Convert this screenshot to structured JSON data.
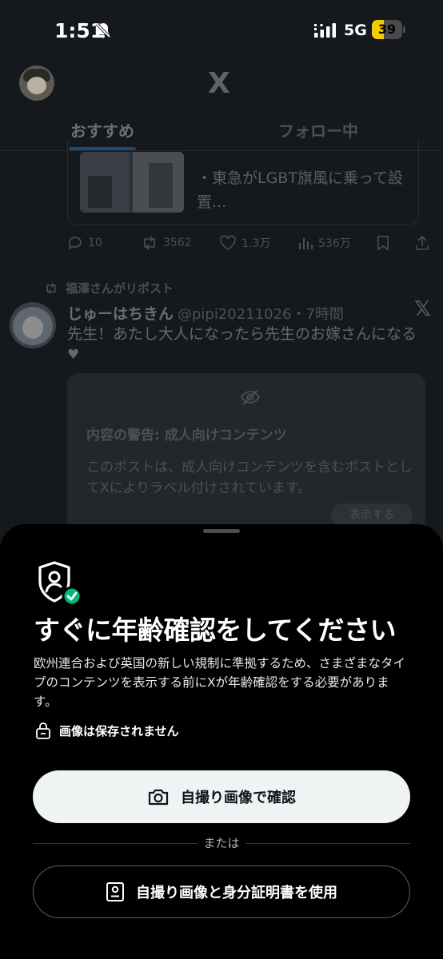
{
  "status_bar": {
    "time": "1:51",
    "network": "5G",
    "battery": "39",
    "battery_level": 0.39
  },
  "header": {
    "logo": "X",
    "tabs": [
      {
        "label": "おすすめ",
        "active": true
      },
      {
        "label": "フォロー中",
        "active": false
      }
    ]
  },
  "feed": {
    "post1": {
      "link_text": "・東急がLGBT旗風に乗って設置...",
      "actions": {
        "replies": "10",
        "reposts": "3562",
        "likes": "1.3万",
        "views": "536万"
      }
    },
    "post2": {
      "repost_by": "福澤さんがリポスト",
      "author": "じゅーはちきん",
      "handle_time": "@pipi20211026・7時間",
      "text": "先生！あたし大人になったら先生のお嫁さんになる",
      "heart": "♥",
      "warning": {
        "title": "内容の警告: 成人向けコンテンツ",
        "body": "このポストは、成人向けコンテンツを含むポストとしてXによりラベル付けされています。",
        "show_label": "表示する"
      }
    }
  },
  "sheet": {
    "title": "すぐに年齢確認をしてください",
    "description": "欧州連合および英国の新しい規制に準拠するため、さまざまなタイプのコンテンツを表示する前にXが年齢確認をする必要があります。",
    "notice": "画像は保存されません",
    "primary_button": "自撮り画像で確認",
    "or_label": "または",
    "secondary_button": "自撮り画像と身分証明書を使用"
  },
  "colors": {
    "sheet_background": "#000000",
    "primary_button_bg": "#eff3f4",
    "verified_badge": "#00ba7c",
    "battery": "#f4cd00"
  }
}
